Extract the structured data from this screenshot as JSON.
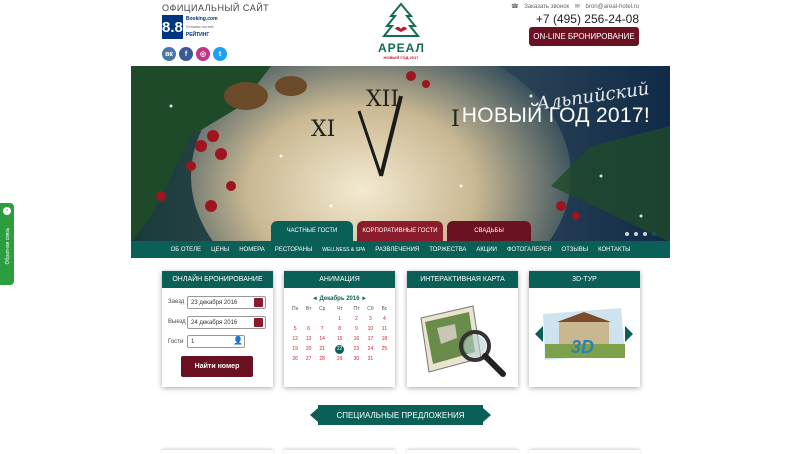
{
  "header": {
    "official": "ОФИЦИАЛЬНЫЙ САЙТ",
    "rating_score": "8.8",
    "rating_brand": "Booking.com",
    "rating_sub": "Отзывы гостей",
    "rating_label": "РЕЙТИНГ",
    "socials": [
      "vk",
      "f",
      "ig",
      "tw"
    ],
    "logo_name": "АРЕАЛ",
    "logo_sub": "НОВЫЙ ГОД 2017",
    "link_call": "Заказать звонок",
    "link_email": "bron@areal-hotel.ru",
    "phone": "+7 (495) 256-24-08",
    "book_button": "ON-LINE БРОНИРОВАНИЕ"
  },
  "hero": {
    "line1": "Альпийский",
    "line2": "НОВЫЙ ГОД 2017!"
  },
  "tabs": [
    "ЧАСТНЫЕ ГОСТИ",
    "КОРПОРАТИВНЫЕ ГОСТИ",
    "СВАДЬБЫ"
  ],
  "nav": [
    "ОБ ОТЕЛЕ",
    "ЦЕНЫ",
    "НОМЕРА",
    "РЕСТОРАНЫ",
    "WELLNESS & SPA",
    "РАЗВЛЕЧЕНИЯ",
    "ТОРЖЕСТВА",
    "АКЦИИ",
    "ФОТОГАЛЕРЕЯ",
    "ОТЗЫВЫ",
    "КОНТАКТЫ"
  ],
  "booking": {
    "title": "ОНЛАЙН БРОНИРОВАНИЕ",
    "checkin_label": "Заезд",
    "checkin_value": "23 декабря 2016",
    "checkout_label": "Выезд",
    "checkout_value": "24 декабря 2016",
    "guests_label": "Гости",
    "guests_value": "1",
    "submit": "Найти номер"
  },
  "animation": {
    "title": "АНИМАЦИЯ",
    "month": "◄  Декабрь 2016  ►",
    "weekdays": [
      "Пн",
      "Вт",
      "Ср",
      "Чт",
      "Пт",
      "Сб",
      "Вс"
    ],
    "weeks": [
      [
        "",
        "",
        "",
        "1",
        "2",
        "3",
        "4"
      ],
      [
        "5",
        "6",
        "7",
        "8",
        "9",
        "10",
        "11"
      ],
      [
        "12",
        "13",
        "14",
        "15",
        "16",
        "17",
        "18"
      ],
      [
        "19",
        "20",
        "21",
        "22",
        "23",
        "24",
        "25"
      ],
      [
        "26",
        "27",
        "28",
        "29",
        "30",
        "31",
        ""
      ]
    ],
    "today": "22"
  },
  "map": {
    "title": "ИНТЕРАКТИВНАЯ КАРТА"
  },
  "tour": {
    "title": "3D-ТУР",
    "badge": "3D"
  },
  "side_tab": "Обратная связь",
  "special_title": "СПЕЦИАЛЬНЫЕ ПРЕДЛОЖЕНИЯ"
}
